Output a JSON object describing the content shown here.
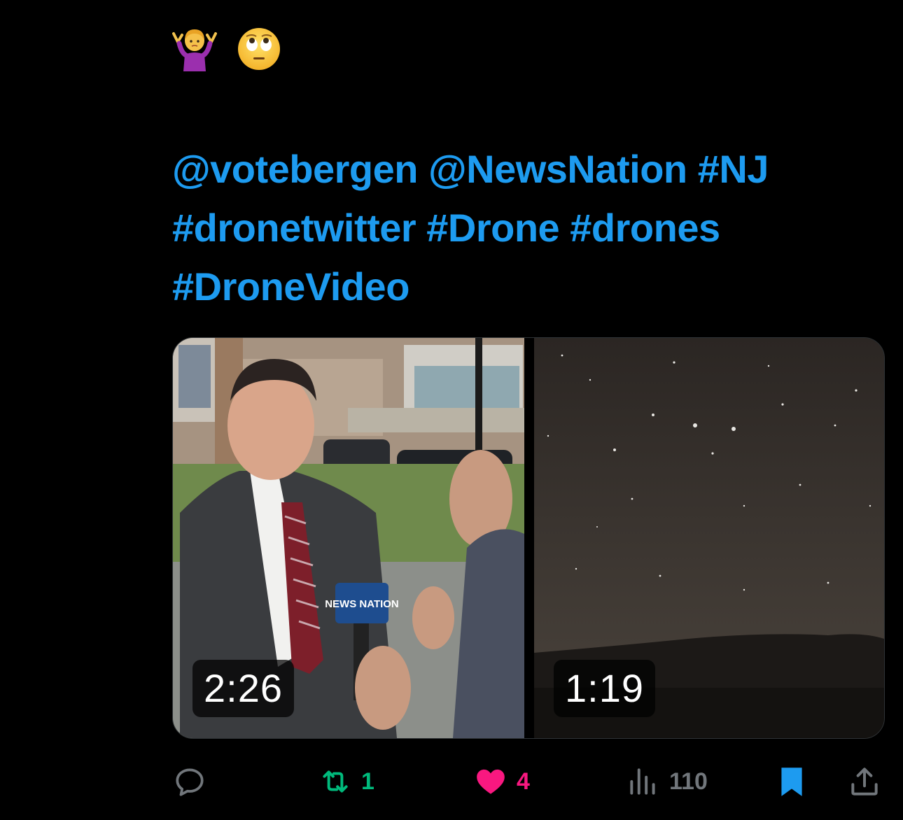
{
  "tweet": {
    "emojis": [
      "person-shrugging-emoji",
      "face-with-rolling-eyes-emoji"
    ],
    "text_tokens": [
      {
        "text": "@votebergen",
        "kind": "mention"
      },
      {
        "text": "@NewsNation",
        "kind": "mention"
      },
      {
        "text": "#NJ",
        "kind": "hashtag"
      },
      {
        "text": "#dronetwitter",
        "kind": "hashtag"
      },
      {
        "text": "#Drone",
        "kind": "hashtag"
      },
      {
        "text": "#drones",
        "kind": "hashtag"
      },
      {
        "text": "#DroneVideo",
        "kind": "hashtag"
      }
    ]
  },
  "media": [
    {
      "duration": "2:26",
      "mic_flag_label": "NEWS NATION"
    },
    {
      "duration": "1:19"
    }
  ],
  "actions": {
    "reply": {
      "icon": "reply-icon"
    },
    "retweet": {
      "icon": "retweet-icon",
      "count": "1"
    },
    "like": {
      "icon": "heart-icon",
      "count": "4"
    },
    "views": {
      "icon": "views-icon",
      "count": "110"
    },
    "bookmark": {
      "icon": "bookmark-icon"
    },
    "share": {
      "icon": "share-icon"
    }
  },
  "colors": {
    "background": "#000000",
    "link": "#1d9bf0",
    "retweet": "#00ba7c",
    "like": "#f91880",
    "muted": "#71767b",
    "bookmark": "#1d9bf0"
  }
}
